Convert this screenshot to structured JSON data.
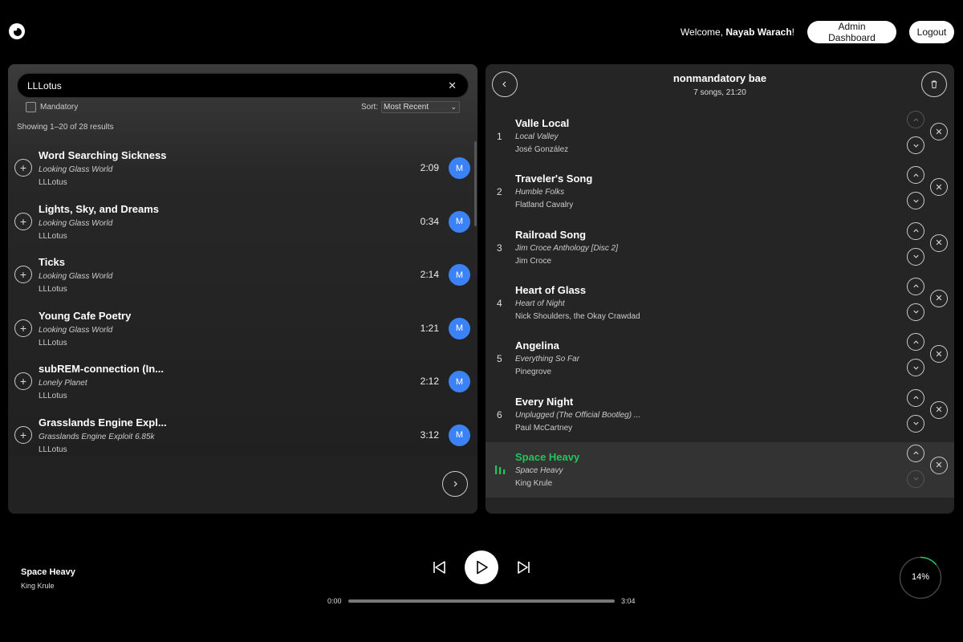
{
  "header": {
    "welcome_prefix": "Welcome, ",
    "user_name": "Nayab Warach",
    "welcome_suffix": "!",
    "admin_label": "Admin Dashboard",
    "logout_label": "Logout"
  },
  "search": {
    "value": "LLLotus",
    "clear_glyph": "✕"
  },
  "filters": {
    "mandatory_label": "Mandatory",
    "mandatory_checked": false,
    "sort_label": "Sort:",
    "sort_value": "Most Recent"
  },
  "results": {
    "summary": "Showing 1–20 of 28 results",
    "badge_letter": "M",
    "items": [
      {
        "title": "Word Searching Sickness",
        "album": "Looking Glass World",
        "artist": "LLLotus",
        "duration": "2:09"
      },
      {
        "title": "Lights, Sky, and Dreams",
        "album": "Looking Glass World",
        "artist": "LLLotus",
        "duration": "0:34"
      },
      {
        "title": "Ticks",
        "album": "Looking Glass World",
        "artist": "LLLotus",
        "duration": "2:14"
      },
      {
        "title": "Young Cafe Poetry",
        "album": "Looking Glass World",
        "artist": "LLLotus",
        "duration": "1:21"
      },
      {
        "title": "subREM-connection (In...",
        "album": "Lonely Planet",
        "artist": "LLLotus",
        "duration": "2:12"
      },
      {
        "title": "Grasslands Engine Expl...",
        "album": "Grasslands Engine Exploit 6.85k",
        "artist": "LLLotus",
        "duration": "3:12"
      }
    ]
  },
  "playlist": {
    "name": "nonmandatory bae",
    "meta": "7 songs, 21:20",
    "tracks": [
      {
        "num": "1",
        "title": "Valle Local",
        "album": "Local Valley",
        "artist": "José González",
        "current": false,
        "up_disabled": true,
        "down_disabled": false
      },
      {
        "num": "2",
        "title": "Traveler's Song",
        "album": "Humble Folks",
        "artist": "Flatland Cavalry",
        "current": false,
        "up_disabled": false,
        "down_disabled": false
      },
      {
        "num": "3",
        "title": "Railroad Song",
        "album": "Jim Croce Anthology [Disc 2]",
        "artist": "Jim Croce",
        "current": false,
        "up_disabled": false,
        "down_disabled": false
      },
      {
        "num": "4",
        "title": "Heart of Glass",
        "album": "Heart of Night",
        "artist": "Nick Shoulders, the Okay Crawdad",
        "current": false,
        "up_disabled": false,
        "down_disabled": false
      },
      {
        "num": "5",
        "title": "Angelina",
        "album": "Everything So Far",
        "artist": "Pinegrove",
        "current": false,
        "up_disabled": false,
        "down_disabled": false
      },
      {
        "num": "6",
        "title": "Every Night",
        "album": "Unplugged (The Official Bootleg) ...",
        "artist": "Paul McCartney",
        "current": false,
        "up_disabled": false,
        "down_disabled": false
      },
      {
        "num": "7",
        "title": "Space Heavy",
        "album": "Space Heavy",
        "artist": "King Krule",
        "current": true,
        "up_disabled": false,
        "down_disabled": true
      }
    ]
  },
  "player": {
    "title": "Space Heavy",
    "artist": "King Krule",
    "time_current": "0:00",
    "time_total": "3:04",
    "progress_fraction": 0,
    "circle_label": "14%",
    "circle_fraction": 0.14
  },
  "colors": {
    "accent_green": "#22c55e",
    "badge_blue": "#3b82f6"
  }
}
